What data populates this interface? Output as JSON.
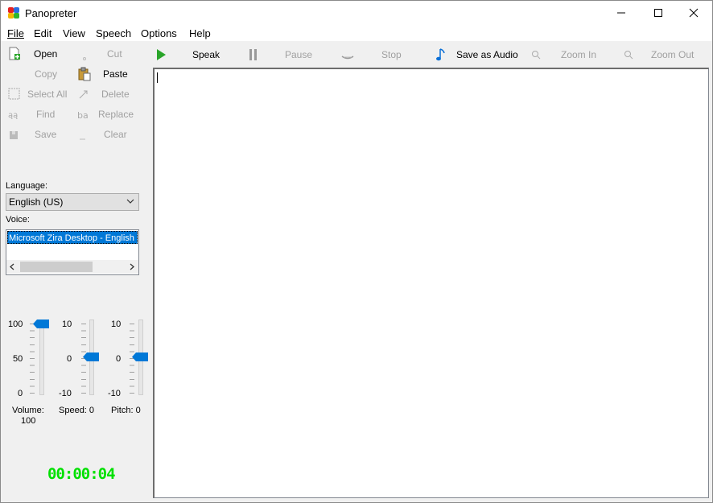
{
  "window": {
    "title": "Panopreter",
    "controls": {
      "minimize_icon": "minimize-icon",
      "maximize_icon": "maximize-icon",
      "close_icon": "close-icon"
    }
  },
  "menu": [
    {
      "label": "File",
      "mnemonic": "F"
    },
    {
      "label": "Edit",
      "mnemonic": "E"
    },
    {
      "label": "View",
      "mnemonic": "V"
    },
    {
      "label": "Speech",
      "mnemonic": "S"
    },
    {
      "label": "Options",
      "mnemonic": "O"
    },
    {
      "label": "Help",
      "mnemonic": "H"
    }
  ],
  "edit_buttons": {
    "open": "Open",
    "cut": "Cut",
    "copy": "Copy",
    "paste": "Paste",
    "select_all": "Select All",
    "delete": "Delete",
    "find": "Find",
    "replace": "Replace",
    "save": "Save",
    "clear": "Clear"
  },
  "toolbar": {
    "speak": "Speak",
    "pause": "Pause",
    "stop": "Stop",
    "save_as_audio": "Save as Audio",
    "zoom_in": "Zoom In",
    "zoom_out": "Zoom Out"
  },
  "language": {
    "label": "Language:",
    "selected": "English (US)"
  },
  "voice": {
    "label": "Voice:",
    "selected": "Microsoft Zira Desktop - English (U"
  },
  "sliders": {
    "volume": {
      "ticks": [
        "100",
        "50",
        "0"
      ],
      "label": "Volume:",
      "value": "100",
      "level": 1.0
    },
    "speed": {
      "ticks": [
        "10",
        "0",
        "-10"
      ],
      "label": "Speed: 0",
      "value": 0,
      "level": 0.5
    },
    "pitch": {
      "ticks": [
        "10",
        "0",
        "-10"
      ],
      "label": "Pitch: 0",
      "value": 0,
      "level": 0.5
    }
  },
  "timer": "00:00:04",
  "colors": {
    "accent": "#0078d7",
    "timer": "#00e000",
    "speak_icon": "#2aa52a"
  },
  "editor": {
    "text": ""
  }
}
